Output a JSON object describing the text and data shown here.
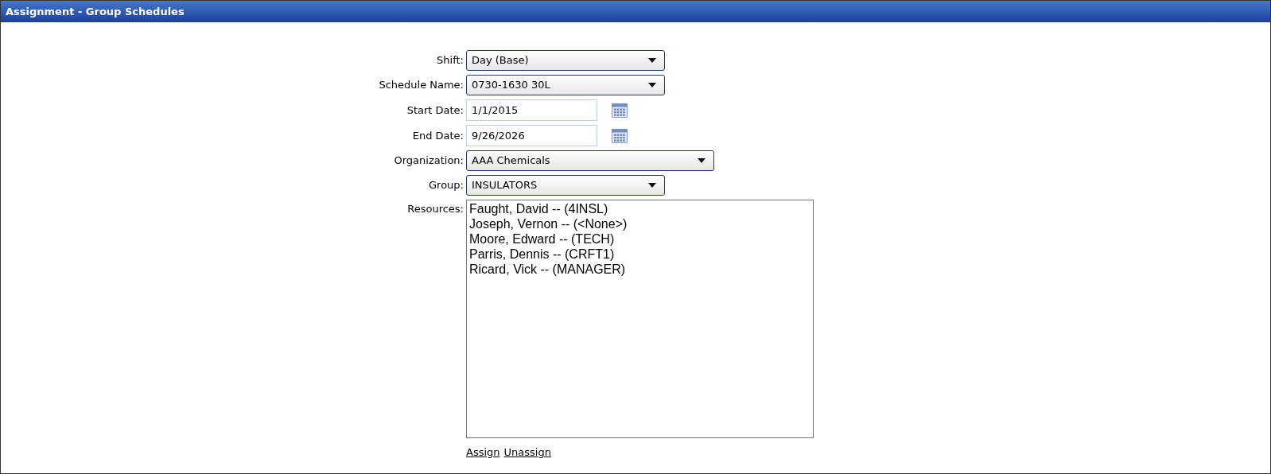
{
  "window": {
    "title": "Assignment - Group Schedules"
  },
  "fields": [
    {
      "kind": "dropdown",
      "label": "Shift:",
      "value": "Day (Base)",
      "wide": false
    },
    {
      "kind": "dropdown",
      "label": "Schedule Name:",
      "value": "0730-1630 30L",
      "wide": false
    },
    {
      "kind": "date",
      "label": "Start Date:",
      "value": "1/1/2015"
    },
    {
      "kind": "date",
      "label": "End Date:",
      "value": "9/26/2026"
    },
    {
      "kind": "dropdown",
      "label": "Organization:",
      "value": "AAA Chemicals",
      "wide": true
    },
    {
      "kind": "dropdown",
      "label": "Group:",
      "value": "INSULATORS",
      "wide": false
    }
  ],
  "resources": {
    "label": "Resources:",
    "items": [
      "Faught, David -- (4INSL)",
      "Joseph, Vernon -- (<None>)",
      "Moore, Edward -- (TECH)",
      "Parris, Dennis -- (CRFT1)",
      "Ricard, Vick -- (MANAGER)"
    ]
  },
  "links": [
    "Assign",
    "Unassign"
  ]
}
